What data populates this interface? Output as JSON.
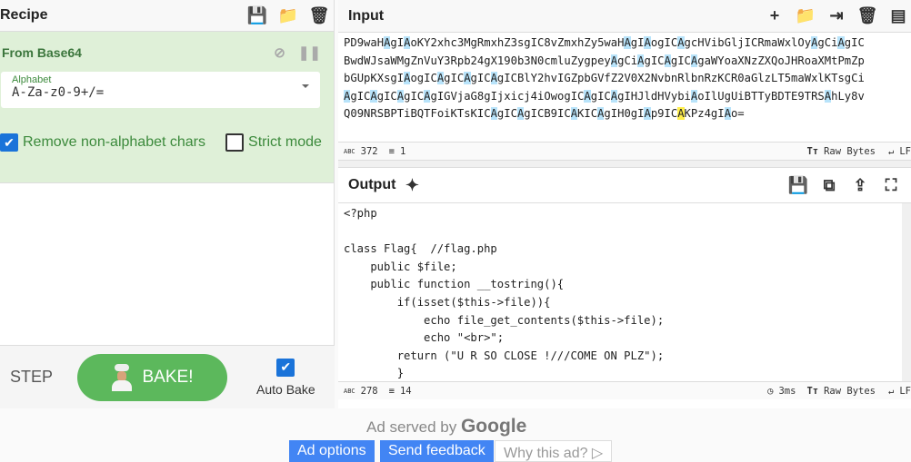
{
  "recipe": {
    "title": "Recipe",
    "icons": [
      "save-icon",
      "folder-icon",
      "trash-icon"
    ],
    "operation": {
      "name": "From Base64",
      "icons": [
        "disable-icon",
        "pause-icon"
      ],
      "alphabet_label": "Alphabet",
      "alphabet_value": "A-Za-z0-9+/=",
      "remove_label": "Remove non-alphabet chars",
      "remove_checked": true,
      "strict_label": "Strict mode",
      "strict_checked": false
    },
    "step_label": "STEP",
    "bake_label": "BAKE!",
    "autobake_label": "Auto Bake",
    "autobake_checked": true
  },
  "input": {
    "title": "Input",
    "icons": [
      "plus-icon",
      "folder-icon",
      "import-icon",
      "trash-icon",
      "layout-icon"
    ],
    "lines": [
      "PD9waHAgIAoKY2xhc3MgRmxhZ3sgIC8vZmxhZy5waHAgIAogICAgcHVibGljICRmaWxlOyAgCiAgIC",
      "BwdWJsaWMgZnVuY3Rpb24gX190b3N0cmluZygpeyAgCiAgICAgICAgaWYoaXNzZXQoJHRoaXMtPmZp",
      "bGUpKXsgIAogICAgICAgICAgICBlY2hvIGZpbGVfZ2V0X2NvbnRlbnRzKCR0aGlzLT5maWxlKTsgCi",
      "AgICAgICAgICAgIGVjaG8gIjxicj4iOwogICAgICAgIHJldHVybiAoIlUgUiBTTyBDTE9TRSAhLy8v",
      "Q09NRSBPTiBQTFoiKTsKICAgICAgICB9ICAKICAgIH0gIAp9ICAKPz4gIAo="
    ],
    "chars": "372",
    "lines_count": "1",
    "format": "Raw Bytes",
    "eol": "LF"
  },
  "output": {
    "title": "Output",
    "icons": [
      "save-icon",
      "copy-icon",
      "replace-input-icon",
      "fullscreen-icon"
    ],
    "lines": [
      "<?php",
      "",
      "class Flag{  //flag.php",
      "    public $file;",
      "    public function __tostring(){",
      "        if(isset($this->file)){",
      "            echo file_get_contents($this->file);",
      "            echo \"<br>\";",
      "        return (\"U R SO CLOSE !///COME ON PLZ\");",
      "        }"
    ],
    "chars": "278",
    "lines_count": "14",
    "time": "3ms",
    "format": "Raw Bytes",
    "eol": "LF"
  },
  "ad": {
    "served_by": "Ad served by",
    "brand": "Google",
    "options": "Ad options",
    "feedback": "Send feedback",
    "why": "Why this ad?"
  }
}
